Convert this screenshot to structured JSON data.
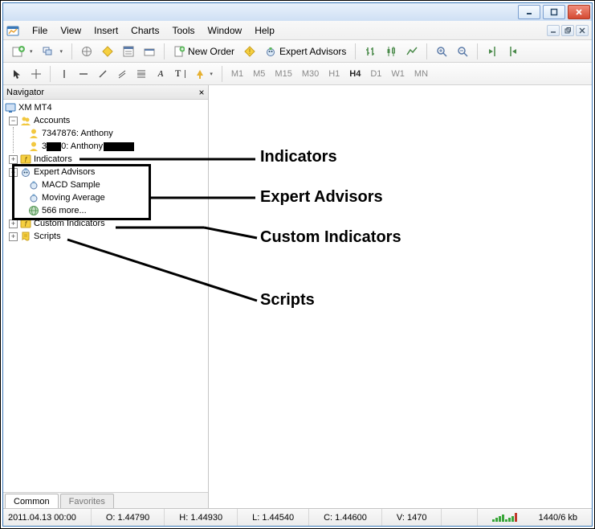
{
  "menu": {
    "items": [
      "File",
      "View",
      "Insert",
      "Charts",
      "Tools",
      "Window",
      "Help"
    ]
  },
  "toolbar1": {
    "new_order": "New Order",
    "expert_advisors": "Expert Advisors"
  },
  "timeframes": [
    "M1",
    "M5",
    "M15",
    "M30",
    "H1",
    "H4",
    "D1",
    "W1",
    "MN"
  ],
  "active_timeframe": "H4",
  "drawing_letters": {
    "a": "A",
    "t": "T"
  },
  "navigator": {
    "title": "Navigator",
    "root": "XM MT4",
    "accounts_label": "Accounts",
    "accounts": [
      "7347876: Anthony",
      "3"
    ],
    "acct2_suffix": "0: Anthony",
    "indicators_label": "Indicators",
    "experts_label": "Expert Advisors",
    "experts": [
      "MACD Sample",
      "Moving Average",
      "566 more..."
    ],
    "custom_label": "Custom Indicators",
    "scripts_label": "Scripts",
    "tabs": {
      "common": "Common",
      "favorites": "Favorites"
    }
  },
  "annotations": {
    "indicators": "Indicators",
    "experts": "Expert Advisors",
    "custom": "Custom Indicators",
    "scripts": "Scripts"
  },
  "status": {
    "datetime": "2011.04.13 00:00",
    "o": "O: 1.44790",
    "h": "H: 1.44930",
    "l": "L: 1.44540",
    "c": "C: 1.44600",
    "v": "V: 1470",
    "net": "1440/6 kb"
  }
}
